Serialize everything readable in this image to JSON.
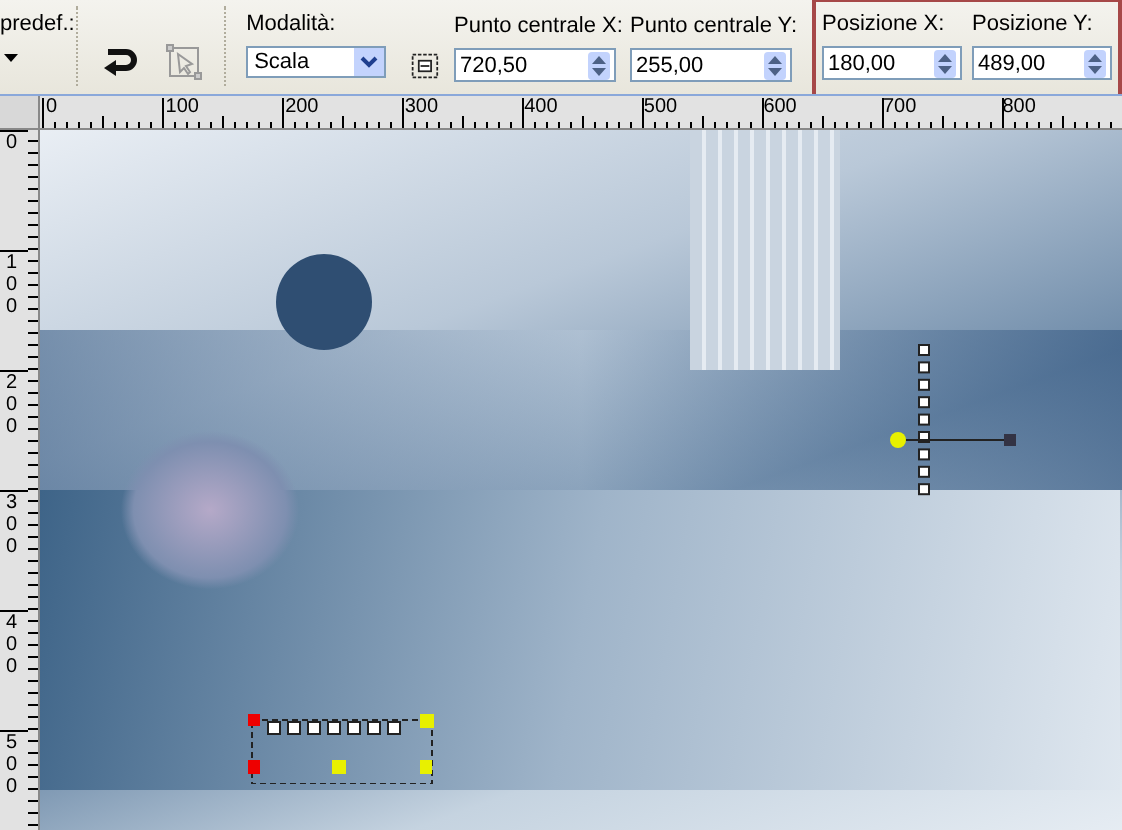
{
  "toolbar": {
    "preset_label": "predef.:",
    "mode": {
      "label": "Modalità:",
      "value": "Scala"
    },
    "field_groups": [
      {
        "highlighted": false,
        "fields": [
          {
            "label": "Punto centrale X:",
            "value": "720,50"
          },
          {
            "label": "Punto centrale Y:",
            "value": "255,00"
          }
        ]
      },
      {
        "highlighted": true,
        "fields": [
          {
            "label": "Posizione X:",
            "value": "180,00"
          },
          {
            "label": "Posizione Y:",
            "value": "489,00"
          }
        ]
      }
    ]
  },
  "rulers": {
    "horizontal": [
      "0",
      "100",
      "200",
      "300",
      "400",
      "500",
      "600",
      "700",
      "800"
    ],
    "vertical": [
      "0",
      "100",
      "200",
      "300",
      "400",
      "500"
    ]
  }
}
